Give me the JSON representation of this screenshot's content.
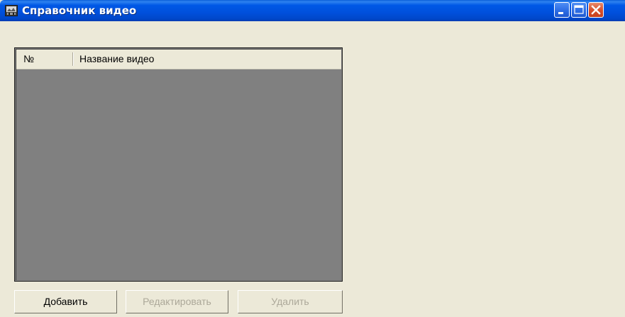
{
  "window": {
    "title": "Справочник видео",
    "icon": "video-catalog-app-icon",
    "controls": [
      "minimize-icon",
      "maximize-icon",
      "close-icon"
    ]
  },
  "list": {
    "columns": [
      {
        "label": "№"
      },
      {
        "label": "Название видео"
      }
    ],
    "rows": []
  },
  "buttons": {
    "add": {
      "label": "Добавить",
      "enabled": true
    },
    "edit": {
      "label": "Редактировать",
      "enabled": false
    },
    "delete": {
      "label": "Удалить",
      "enabled": false
    }
  },
  "colors": {
    "titlebar": "#0054e3",
    "window_bg": "#ece9d8",
    "list_bg": "#808080",
    "close_button": "#d8512d",
    "disabled_text": "#aca899"
  }
}
